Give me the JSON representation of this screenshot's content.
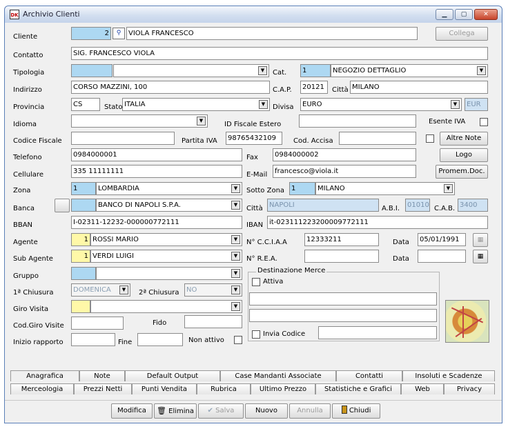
{
  "window": {
    "title": "Archivio Clienti",
    "min_glyph": "▁",
    "max_glyph": "▢",
    "close_glyph": "✕",
    "icon_text": "DK"
  },
  "labels": {
    "cliente": "Cliente",
    "contatto": "Contatto",
    "tipologia": "Tipologia",
    "cat": "Cat.",
    "indirizzo": "Indirizzo",
    "cap": "C.A.P.",
    "citta": "Città",
    "provincia": "Provincia",
    "stato": "Stato",
    "divisa": "Divisa",
    "idioma": "Idioma",
    "id_fiscale_estero": "ID Fiscale Estero",
    "esente_iva": "Esente IVA",
    "codice_fiscale": "Codice Fiscale",
    "partita_iva": "Partita IVA",
    "cod_accisa": "Cod. Accisa",
    "telefono": "Telefono",
    "fax": "Fax",
    "cellulare": "Cellulare",
    "email": "E-Mail",
    "zona": "Zona",
    "sotto_zona": "Sotto Zona",
    "banca": "Banca",
    "citta_banca": "Città",
    "abi": "A.B.I.",
    "cab": "C.A.B.",
    "bban": "BBAN",
    "iban": "IBAN",
    "agente": "Agente",
    "ncciaa": "N° C.C.I.A.A",
    "data": "Data",
    "sub_agente": "Sub Agente",
    "nrea": "N° R.E.A.",
    "data2": "Data",
    "gruppo": "Gruppo",
    "dest_merce": "Destinazione Merce",
    "attiva": "Attiva",
    "chiusura1": "1ª Chiusura",
    "chiusura2": "2ª Chiusura",
    "giro_visita": "Giro Visita",
    "cod_giro_visite": "Cod.Giro Visite",
    "fido": "Fido",
    "inizio_rapporto": "Inizio rapporto",
    "fine": "Fine",
    "non_attivo": "Non attivo",
    "invia_codice": "Invia Codice"
  },
  "fields": {
    "cliente_id": "2",
    "cliente_name": "VIOLA FRANCESCO",
    "contatto": "SIG. FRANCESCO VIOLA",
    "tipologia": "",
    "cat_code": "1",
    "cat_name": "NEGOZIO DETTAGLIO",
    "indirizzo": "CORSO MAZZINI, 100",
    "cap": "20121",
    "citta": "MILANO",
    "provincia": "CS",
    "stato": "ITALIA",
    "divisa": "EURO",
    "divisa_code": "EUR",
    "idioma": "",
    "id_fiscale_estero": "",
    "codice_fiscale": "",
    "partita_iva": "98765432109",
    "cod_accisa": "",
    "telefono": "0984000001",
    "fax": "0984000002",
    "cellulare": "335 11111111",
    "email": "francesco@viola.it",
    "zona_code": "1",
    "zona_name": "LOMBARDIA",
    "sotto_zona_code": "1",
    "sotto_zona_name": "MILANO",
    "banca_code": "",
    "banca_name": "BANCO DI NAPOLI S.P.A.",
    "banca_citta": "NAPOLI",
    "abi": "01010",
    "cab": "3400",
    "bban": "I-02311-12232-000000772111",
    "iban": "it-023111223200009772111",
    "agente_code": "1",
    "agente_name": "ROSSI MARIO",
    "ncciaa": "12333211",
    "data_cciaa": "05/01/1991",
    "sub_agente_code": "1",
    "sub_agente_name": "VERDI LUIGI",
    "nrea": "",
    "data_rea": "",
    "gruppo": "",
    "dest1": "",
    "dest2": "",
    "chiusura1": "DOMENICA",
    "chiusura2": "NO",
    "giro_visita": "",
    "cod_giro_visite": "",
    "fido": "",
    "inizio_rapporto": "",
    "fine": "",
    "invia_codice": ""
  },
  "buttons": {
    "collega": "Collega",
    "altre_note": "Altre Note",
    "logo": "Logo",
    "promem": "Promem.Doc."
  },
  "tabs_row1": [
    "Anagrafica",
    "Note",
    "Default Output",
    "Case Mandanti Associate",
    "Contatti",
    "Insoluti e Scadenze"
  ],
  "tabs_row2": [
    "Merceologia",
    "Prezzi Netti",
    "Punti Vendita",
    "Rubrica",
    "Ultimo Prezzo",
    "Statistiche e Grafici",
    "Web",
    "Privacy"
  ],
  "toolbar": {
    "modifica": "Modifica",
    "elimina": "Elimina",
    "salva": "Salva",
    "nuovo": "Nuovo",
    "annulla": "Annulla",
    "chiudi": "Chiudi"
  }
}
